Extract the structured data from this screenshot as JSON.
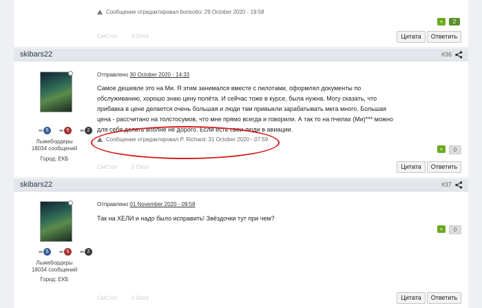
{
  "post35": {
    "edit_note": "Сообщение отредактировал borisotto: 29 October 2020 - 19:58",
    "rep_up": "+",
    "rep_value": "2",
    "faded_left": "СмСтоп",
    "faded_right": "0 Олга",
    "quote_label": "Цитата",
    "reply_label": "Ответить"
  },
  "post36": {
    "author": "skibars22",
    "number": "#36",
    "sent_prefix": "Отправлено",
    "date": "30 October 2020 - 14:33",
    "user_group": "Лыжебордеры",
    "user_posts": "18034 сообщений",
    "user_city": "Город: ЕКБ",
    "badges": [
      "5",
      "5",
      "2"
    ],
    "text": "Самое дешевле это на Ми. Я этим занимался вместе с пилотами, оформлял документы по обслуживанию, хорошо знаю цену полёта. И сейчас тоже в курсе, была нужна. Могу сказать, что прибавка в цене делается очень большая и люди там привыкли зарабатывать мега много. Большая цена - рассчитано на толстосумов, что мне прямо всегда и говорили. А так то на пчелах (Ми)*** можно для себя делать вполне не дорого. Если есть свои люди в авиации.",
    "edit_note": "Сообщение отредактировал P. Richard: 31 October 2020 - 07:59",
    "rep_up": "+",
    "rep_value": "0",
    "faded_left": "СмСтоп",
    "faded_right": "0 Олга",
    "quote_label": "Цитата",
    "reply_label": "Ответить"
  },
  "post37": {
    "author": "skibars22",
    "number": "#37",
    "sent_prefix": "Отправлено",
    "date": "01 November 2020 - 09:58",
    "user_group": "Лыжебордеры",
    "user_posts": "18034 сообщений",
    "user_city": "Город: ЕКБ",
    "badges": [
      "5",
      "5",
      "2"
    ],
    "text": "Так на ХЕЛИ и надо было исправить! Звёздочки тут при чем?",
    "rep_up": "+",
    "rep_value": "0",
    "faded_left": "СмСтоп",
    "faded_right": "0 Олга",
    "quote_label": "Цитата",
    "reply_label": "Ответить"
  }
}
